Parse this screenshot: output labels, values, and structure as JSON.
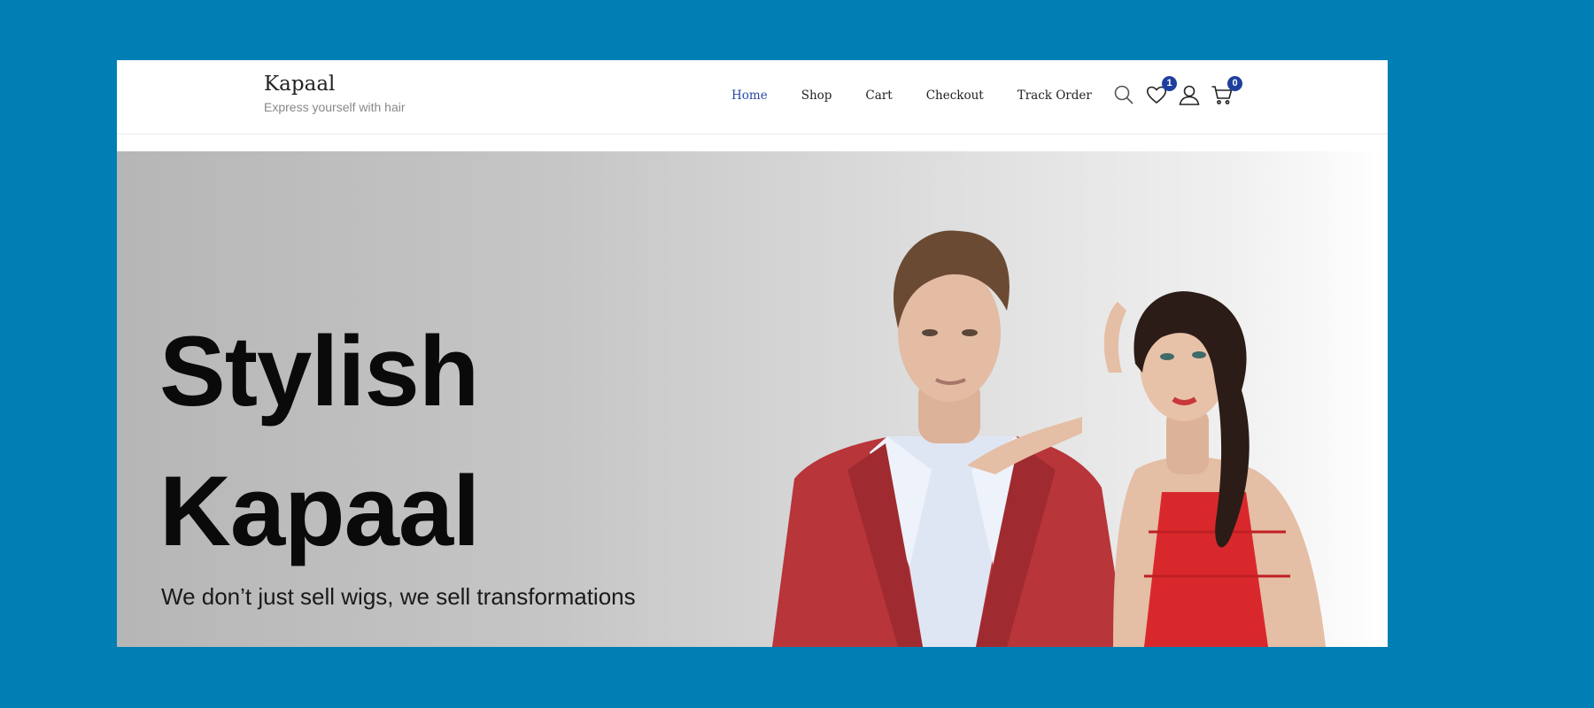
{
  "site": {
    "title": "Kapaal",
    "tagline": "Express yourself with hair"
  },
  "nav": {
    "items": [
      {
        "label": "Home",
        "active": true
      },
      {
        "label": "Shop",
        "active": false
      },
      {
        "label": "Cart",
        "active": false
      },
      {
        "label": "Checkout",
        "active": false
      },
      {
        "label": "Track Order",
        "active": false
      }
    ]
  },
  "header_icons": {
    "wishlist_count": "1",
    "cart_count": "0"
  },
  "hero": {
    "title_line1": "Stylish",
    "title_line2": "Kapaal",
    "subtitle": "We don’t just sell wigs, we sell transformations"
  },
  "colors": {
    "page_background": "#007fb5",
    "accent": "#2a4aa6",
    "badge": "#1e3f9e",
    "jacket": "#b8353a",
    "dress": "#d9282c"
  }
}
